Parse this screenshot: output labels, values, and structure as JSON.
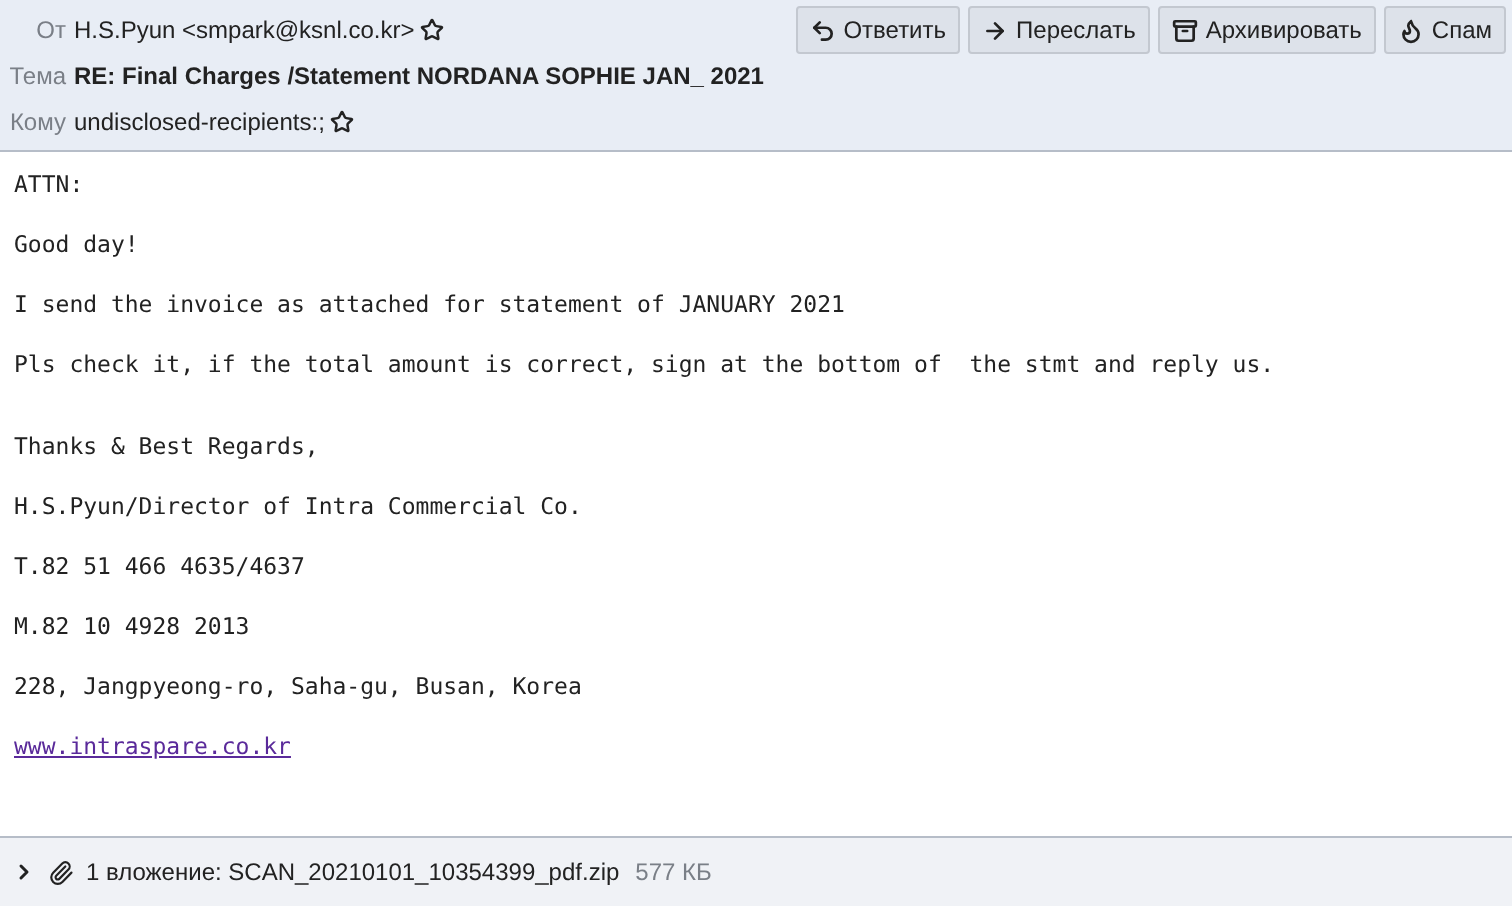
{
  "header": {
    "fields": [
      {
        "label": "От",
        "value": "H.S.Pyun <smpark@ksnl.co.kr>",
        "starred": false,
        "bold": false
      },
      {
        "label": "Тема",
        "value": "RE: Final Charges /Statement NORDANA SOPHIE JAN_ 2021",
        "bold": true
      },
      {
        "label": "Кому",
        "value": "undisclosed-recipients:;",
        "starred": false,
        "bold": false
      }
    ],
    "buttons": [
      {
        "kind": "reply",
        "label": "Ответить"
      },
      {
        "kind": "forward",
        "label": "Переслать"
      },
      {
        "kind": "archive",
        "label": "Архивировать"
      },
      {
        "kind": "spam",
        "label": "Спам"
      }
    ]
  },
  "body": [
    [
      {
        "kind": "text",
        "text": "ATTN:"
      },
      {
        "kind": "text",
        "text": "Good day!"
      },
      {
        "kind": "text",
        "text": "I send the invoice as attached for statement of JANUARY 2021"
      },
      {
        "kind": "text",
        "text": "Pls check it, if the total amount is correct, sign at the bottom of  the stmt and reply us."
      }
    ],
    [
      {
        "kind": "text",
        "text": "Thanks & Best Regards,"
      },
      {
        "kind": "text",
        "text": "H.S.Pyun/Director of Intra Commercial Co."
      },
      {
        "kind": "text",
        "text": "T.82 51 466 4635/4637"
      },
      {
        "kind": "text",
        "text": "M.82 10 4928 2013"
      },
      {
        "kind": "text",
        "text": "228, Jangpyeong-ro, Saha-gu, Busan, Korea"
      },
      {
        "kind": "link",
        "text": "www.intraspare.co.kr"
      }
    ]
  ],
  "attachments": {
    "expanded": false,
    "summary": "1 вложение: SCAN_20210101_10354399_pdf.zip",
    "size": "577 КБ"
  }
}
